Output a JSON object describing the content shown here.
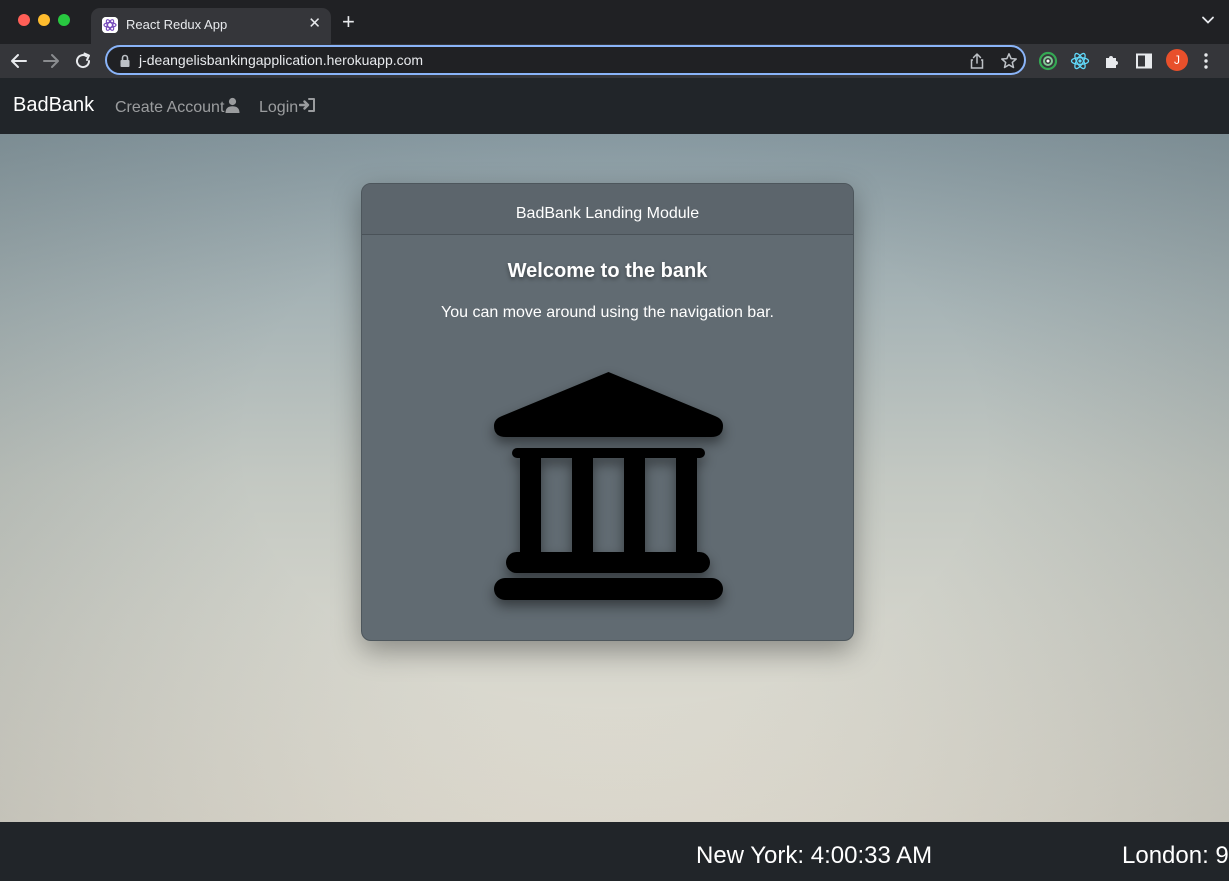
{
  "browser": {
    "tab_title": "React Redux App",
    "url": "j-deangelisbankingapplication.herokuapp.com",
    "profile_initial": "J"
  },
  "navbar": {
    "brand": "BadBank",
    "links": [
      {
        "label": "Create Account",
        "icon": "user-icon"
      },
      {
        "label": "Login",
        "icon": "login-icon"
      }
    ]
  },
  "card": {
    "header": "BadBank Landing Module",
    "title": "Welcome to the bank",
    "text": "You can move around using the navigation bar.",
    "icon": "bank-building-icon"
  },
  "clocks": {
    "new_york": "New York: 4:00:33 AM",
    "london": "London: 9:"
  },
  "colors": {
    "navbar_bg": "#212529",
    "card_bg": "#616b72",
    "omnibox_focus": "#8ab4f8",
    "avatar_bg": "#e8502b"
  }
}
